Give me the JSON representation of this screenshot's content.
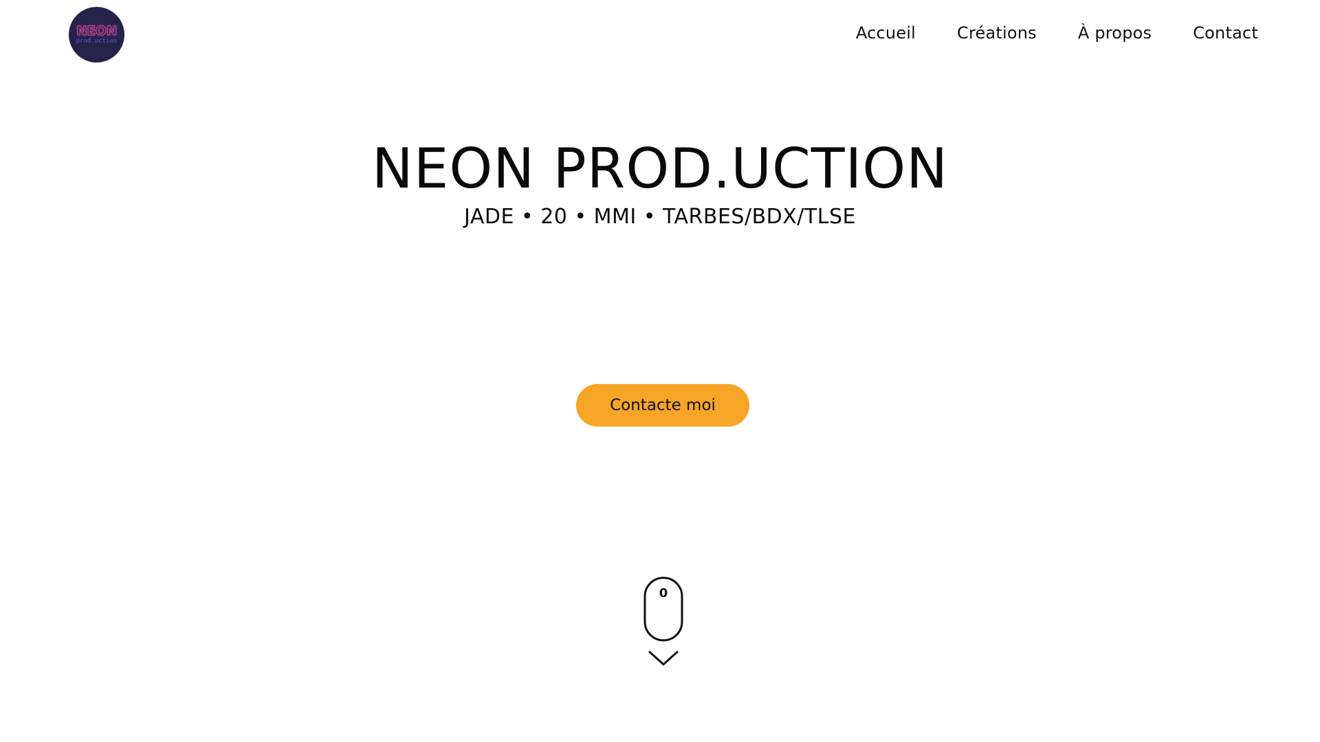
{
  "header": {
    "logo": {
      "line1": "NEON",
      "line2": "prod.uction",
      "bg_color": "#25234a",
      "neon_color": "#d8468f",
      "accent_color": "#4a4bb0"
    },
    "nav": {
      "items": [
        {
          "label": "Accueil"
        },
        {
          "label": "Créations"
        },
        {
          "label": "À propos"
        },
        {
          "label": "Contact"
        }
      ]
    }
  },
  "hero": {
    "title": "NEON PROD.UCTION",
    "subtitle": "JADE • 20 • MMI • TARBES/BDX/TLSE"
  },
  "cta": {
    "label": "Contacte moi",
    "color": "#f7a526"
  },
  "scroll_indicator": {
    "counter": "0",
    "mouse_icon": "mouse-icon",
    "chevron_icon": "chevron-down-icon"
  }
}
